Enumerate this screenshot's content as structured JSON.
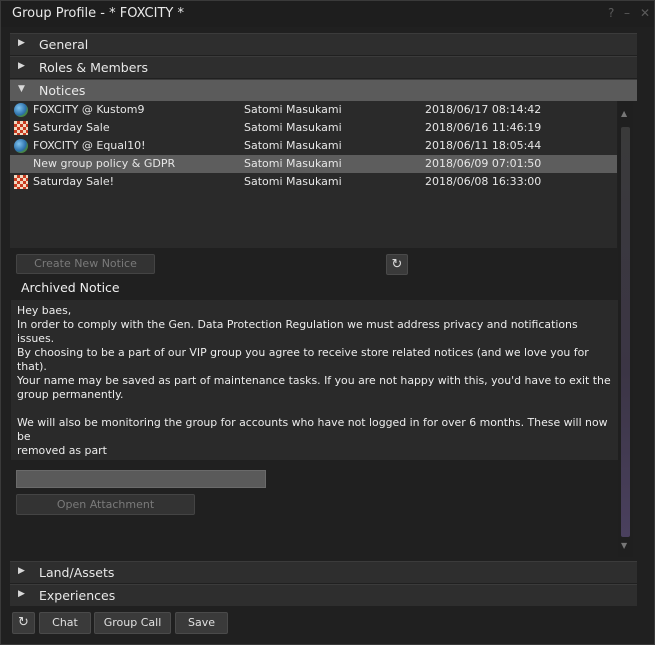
{
  "window": {
    "title": "Group Profile - * FOXCITY *",
    "help": "?",
    "minimize": "–",
    "close": "✕"
  },
  "sections": {
    "general": "General",
    "roles": "Roles & Members",
    "notices": "Notices",
    "land": "Land/Assets",
    "experiences": "Experiences"
  },
  "notices": {
    "items": [
      {
        "icon": "globe-icon",
        "subject": "FOXCITY @ Kustom9",
        "from": "Satomi Masukami",
        "date": "2018/06/17 08:14:42"
      },
      {
        "icon": "checker-icon",
        "subject": "Saturday Sale",
        "from": "Satomi Masukami",
        "date": "2018/06/16 11:46:19"
      },
      {
        "icon": "globe-icon",
        "subject": "FOXCITY @ Equal10!",
        "from": "Satomi Masukami",
        "date": "2018/06/11 18:05:44"
      },
      {
        "icon": "",
        "subject": "New group policy & GDPR",
        "from": "Satomi Masukami",
        "date": "2018/06/09 07:01:50"
      },
      {
        "icon": "checker-icon",
        "subject": "Saturday Sale!",
        "from": "Satomi Masukami",
        "date": "2018/06/08 16:33:00"
      }
    ],
    "selected_index": 3,
    "create_button": "Create New Notice",
    "archived_title": "Archived Notice",
    "body": "Hey baes,\nIn order to comply with the Gen. Data Protection Regulation we must address privacy and notifications issues.\nBy choosing to be a part of our VIP group you agree to receive store related notices (and we love you for that).\nYour name may be saved as part of maintenance tasks. If you are not happy with this, you'd have to exit the\ngroup permanently.\n\nWe will also be monitoring the group for accounts who have not logged in for over 6 months. These will now be\nremoved as part",
    "attachment_value": "",
    "open_attachment": "Open Attachment"
  },
  "footer": {
    "refresh_icon": "refresh-icon",
    "chat": "Chat",
    "group_call": "Group Call",
    "save": "Save"
  },
  "colors": {
    "selected_row": "#5d5d5d",
    "open_section": "#5b5b5b",
    "panel": "#2e2e2e"
  }
}
